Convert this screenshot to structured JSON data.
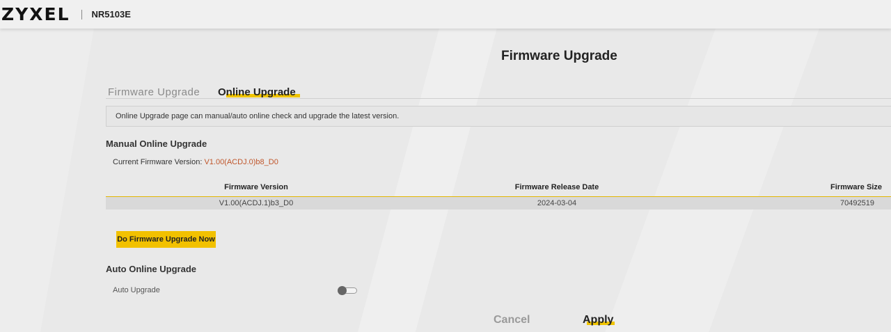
{
  "header": {
    "logo": "ZYXEL",
    "model": "NR5103E"
  },
  "page": {
    "title": "Firmware Upgrade"
  },
  "tabs": [
    {
      "label": "Firmware Upgrade",
      "active": false
    },
    {
      "label": "Online Upgrade",
      "active": true
    }
  ],
  "info": {
    "text": "Online Upgrade page can manual/auto online check and upgrade the latest version."
  },
  "manual": {
    "title": "Manual Online Upgrade",
    "current_label": "Current Firmware Version: ",
    "current_version": "V1.00(ACDJ.0)b8_D0",
    "table": {
      "headers": [
        "Firmware Version",
        "Firmware Release Date",
        "Firmware Size"
      ],
      "rows": [
        [
          "V1.00(ACDJ.1)b3_D0",
          "2024-03-04",
          "70492519"
        ]
      ]
    },
    "upgrade_button": "Do Firmware Upgrade Now"
  },
  "auto": {
    "title": "Auto Online Upgrade",
    "label": "Auto Upgrade",
    "enabled": false
  },
  "actions": {
    "cancel": "Cancel",
    "apply": "Apply"
  },
  "colors": {
    "accent": "#f0c400",
    "version_highlight": "#c0562b"
  }
}
